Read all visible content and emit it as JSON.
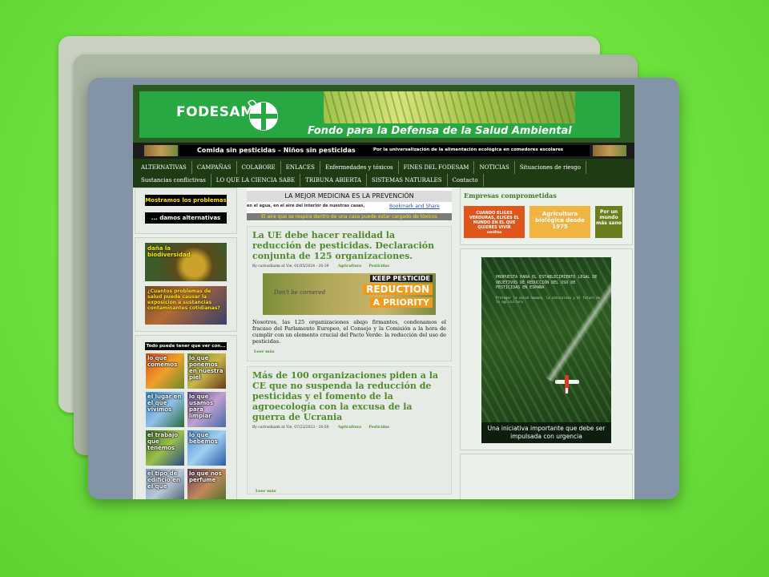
{
  "header": {
    "logo_text": "FODESAM",
    "tagline": "Fondo para la Defensa de la Salud Ambiental"
  },
  "strip": {
    "left_text": "Comida sin pesticidas – Niños sin pesticidas",
    "right_text": "Por la universalización de la alimentación ecológica en comedores escolares"
  },
  "nav": {
    "items": [
      "ALTERNATIVAS",
      "CAMPAÑAS",
      "COLABORE",
      "ENLACES",
      "Enfermedades y tóxicos",
      "FINES DEL FODESAM",
      "NOTICIAS",
      "Situaciones de riesgo",
      "Sustancias conflictivas",
      "LO QUE LA CIENCIA SABE",
      "TRIBUNA ABIERTA",
      "SISTEMAS NATURALES",
      "Contacto"
    ]
  },
  "left": {
    "btn1": "Mostramos los problemas",
    "btn2": "... damos alternativas",
    "photo1": "daña la biodiversidad",
    "photo2": "¿Cuantos problemas de salud puede causar la exposición a sustancias contaminantes cotidianas?",
    "grid_title": "Todo puede tener que ver con...",
    "tiles": [
      "lo que comemos",
      "lo que ponemos en nuestra piel",
      "el lugar en el que vivimos",
      "lo que usamos para limpiar",
      "el trabajo que tenemos",
      "lo que bebemos",
      "el tipo de edificio en el que",
      "lo que nos perfume"
    ]
  },
  "center": {
    "banner_title": "LA MEJOR MEDICINA ES LA PREVENCIÓN",
    "banner_sub": "en el agua, en el aire del interior de nuestras casas,",
    "bookmark": "Bookmark and Share",
    "banner_bottom": "El aire que se respira dentro de una casa puede estar cargado de tóxicos",
    "articles": [
      {
        "title": "La UE debe hacer realidad la reducción de pesticidas. Declaración conjunta de 125 organizaciones.",
        "meta": "By carlosdiazm at Vie, 01/05/2024 - 20:39",
        "tag1": "Agricultura",
        "tag2": "Pesticidas",
        "img_l1": "KEEP PESTICIDE",
        "img_l2": "REDUCTION",
        "img_l3": "A PRIORITY",
        "img_sig": "Don't be cornered",
        "body": "Nosotros, las 125 organizaciones abajo firmantes, condenamos el fracaso del Parlamento Europeo, el Consejo y la Comisión a la hora de cumplir con un elemento crucial del Pacto Verde: la reducción del uso de pesticidas.",
        "more": "Leer más"
      },
      {
        "title": "Más de 100 organizaciones piden a la CE que no suspenda la reducción de pesticidas y el fomento de la agroecología con la excusa de la guerra de Ucrania",
        "meta": "By carlosdiazm at Vie, 07/22/2023 - 20:50",
        "tag1": "Agricultura",
        "tag2": "Pesticidas",
        "more": "Leer más"
      }
    ]
  },
  "right": {
    "companies_title": "Empresas comprometidas",
    "ad1": "CUANDO ELIGES VERDURAS, ELIGES EL MUNDO EN EL QUE QUIERES VIVIR",
    "ad1_brand": "verditas",
    "ad2": "Agricultura biológica desde 1975",
    "ad3": "Por un mundo más sano",
    "poster_title": "PROPUESTA PARA EL ESTABLECIMIENTO LEGAL DE OBJETIVOS DE REDUCCIÓN DEL USO DE PESTICIDAS EN ESPAÑA",
    "poster_sub": "Proteger la salud humana, la naturaleza y el futuro de la agricultura",
    "poster_caption": "Una iniciativa importante que debe ser impulsada con urgencia"
  }
}
